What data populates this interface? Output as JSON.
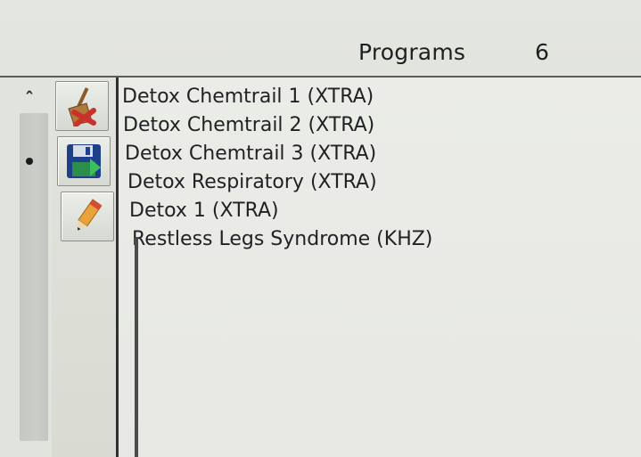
{
  "header": {
    "title": "Programs",
    "count": "6"
  },
  "scrollbar": {
    "up_icon": "chevron-up-icon",
    "thumb_icon": "dot-icon"
  },
  "toolbar": {
    "buttons": [
      {
        "icon": "broom-delete-icon"
      },
      {
        "icon": "floppy-save-icon"
      },
      {
        "icon": "pencil-edit-icon"
      }
    ]
  },
  "programs": {
    "items": [
      {
        "label": "Detox Chemtrail 1 (XTRA)"
      },
      {
        "label": "Detox Chemtrail 2 (XTRA)"
      },
      {
        "label": "Detox Chemtrail 3 (XTRA)"
      },
      {
        "label": "Detox Respiratory (XTRA)"
      },
      {
        "label": "Detox 1 (XTRA)"
      },
      {
        "label": "Restless Legs Syndrome (KHZ)"
      }
    ]
  },
  "colors": {
    "text": "#1f2124",
    "panel": "#e8e9e4",
    "delete_accent": "#c8322a",
    "save_accent": "#1e7a3a",
    "edit_accent": "#e8a23a"
  }
}
